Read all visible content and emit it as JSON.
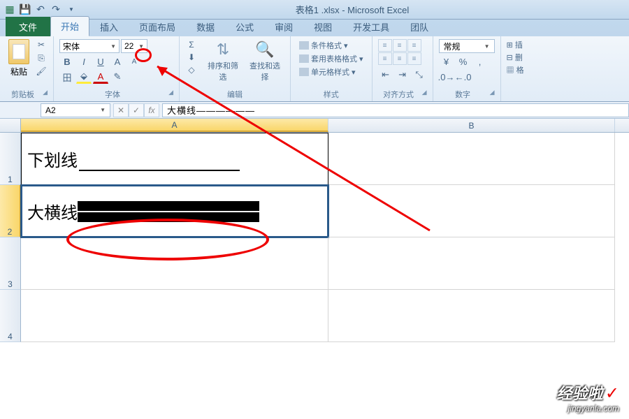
{
  "title": "表格1 .xlsx - Microsoft Excel",
  "tabs": {
    "file": "文件",
    "home": "开始",
    "insert": "插入",
    "pageLayout": "页面布局",
    "data": "数据",
    "formulas": "公式",
    "review": "审阅",
    "view": "视图",
    "developer": "开发工具",
    "team": "团队"
  },
  "ribbon": {
    "clipboard": {
      "label": "剪贴板",
      "paste": "粘贴"
    },
    "font": {
      "label": "字体",
      "name": "宋体",
      "size": "22"
    },
    "editing": {
      "label": "编辑",
      "sort": "排序和筛选",
      "find": "查找和选择"
    },
    "styles": {
      "label": "样式",
      "conditional": "条件格式",
      "tableFormat": "套用表格格式",
      "cellStyles": "单元格样式"
    },
    "alignment": {
      "label": "对齐方式"
    },
    "number": {
      "label": "数字",
      "format": "常规"
    },
    "cells": {
      "insert": "插",
      "delete": "删",
      "format": "格"
    }
  },
  "formulaBar": {
    "nameBox": "A2",
    "formula": "大横线——————"
  },
  "columns": {
    "A": "A",
    "B": "B"
  },
  "rows": {
    "r1": "1",
    "r2": "2",
    "r3": "3",
    "r4": "4"
  },
  "cellData": {
    "A1_text": "下划线",
    "A2_text": "大横线"
  },
  "watermark": {
    "main": "经验啦",
    "sub": "jingyanla.com"
  }
}
